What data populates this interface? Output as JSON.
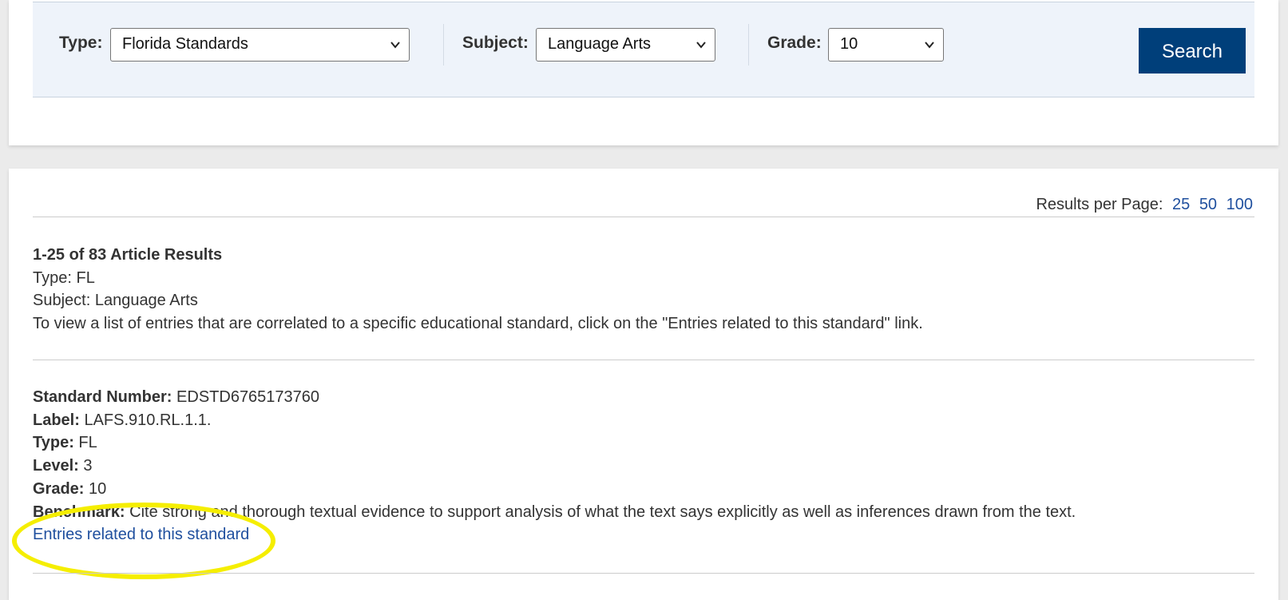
{
  "filters": {
    "type_label": "Type:",
    "type_value": "Florida Standards",
    "subject_label": "Subject:",
    "subject_value": "Language Arts",
    "grade_label": "Grade:",
    "grade_value": "10",
    "search_label": "Search"
  },
  "results_per_page": {
    "label": "Results per Page:",
    "options": [
      "25",
      "50",
      "100"
    ]
  },
  "summary": {
    "count": "1-25 of 83 Article Results",
    "type": "Type: FL",
    "subject": "Subject: Language Arts",
    "instructions": "To view a list of entries that are correlated to a specific educational standard, click on the \"Entries related to this standard\" link."
  },
  "standard": {
    "number_label": "Standard Number:",
    "number_value": "EDSTD6765173760",
    "label_label": "Label:",
    "label_value": "LAFS.910.RL.1.1.",
    "type_label": "Type:",
    "type_value": "FL",
    "level_label": "Level:",
    "level_value": "3",
    "grade_label": "Grade:",
    "grade_value": "10",
    "benchmark_label": "Benchmark:",
    "benchmark_value": "Cite strong and thorough textual evidence to support analysis of what the text says explicitly as well as inferences drawn from the text.",
    "entries_link": "Entries related to this standard"
  },
  "colors": {
    "accent": "#003f7a",
    "link": "#1f4f9e",
    "highlight": "#f5ee00",
    "filter_bg": "#eef3fa"
  }
}
